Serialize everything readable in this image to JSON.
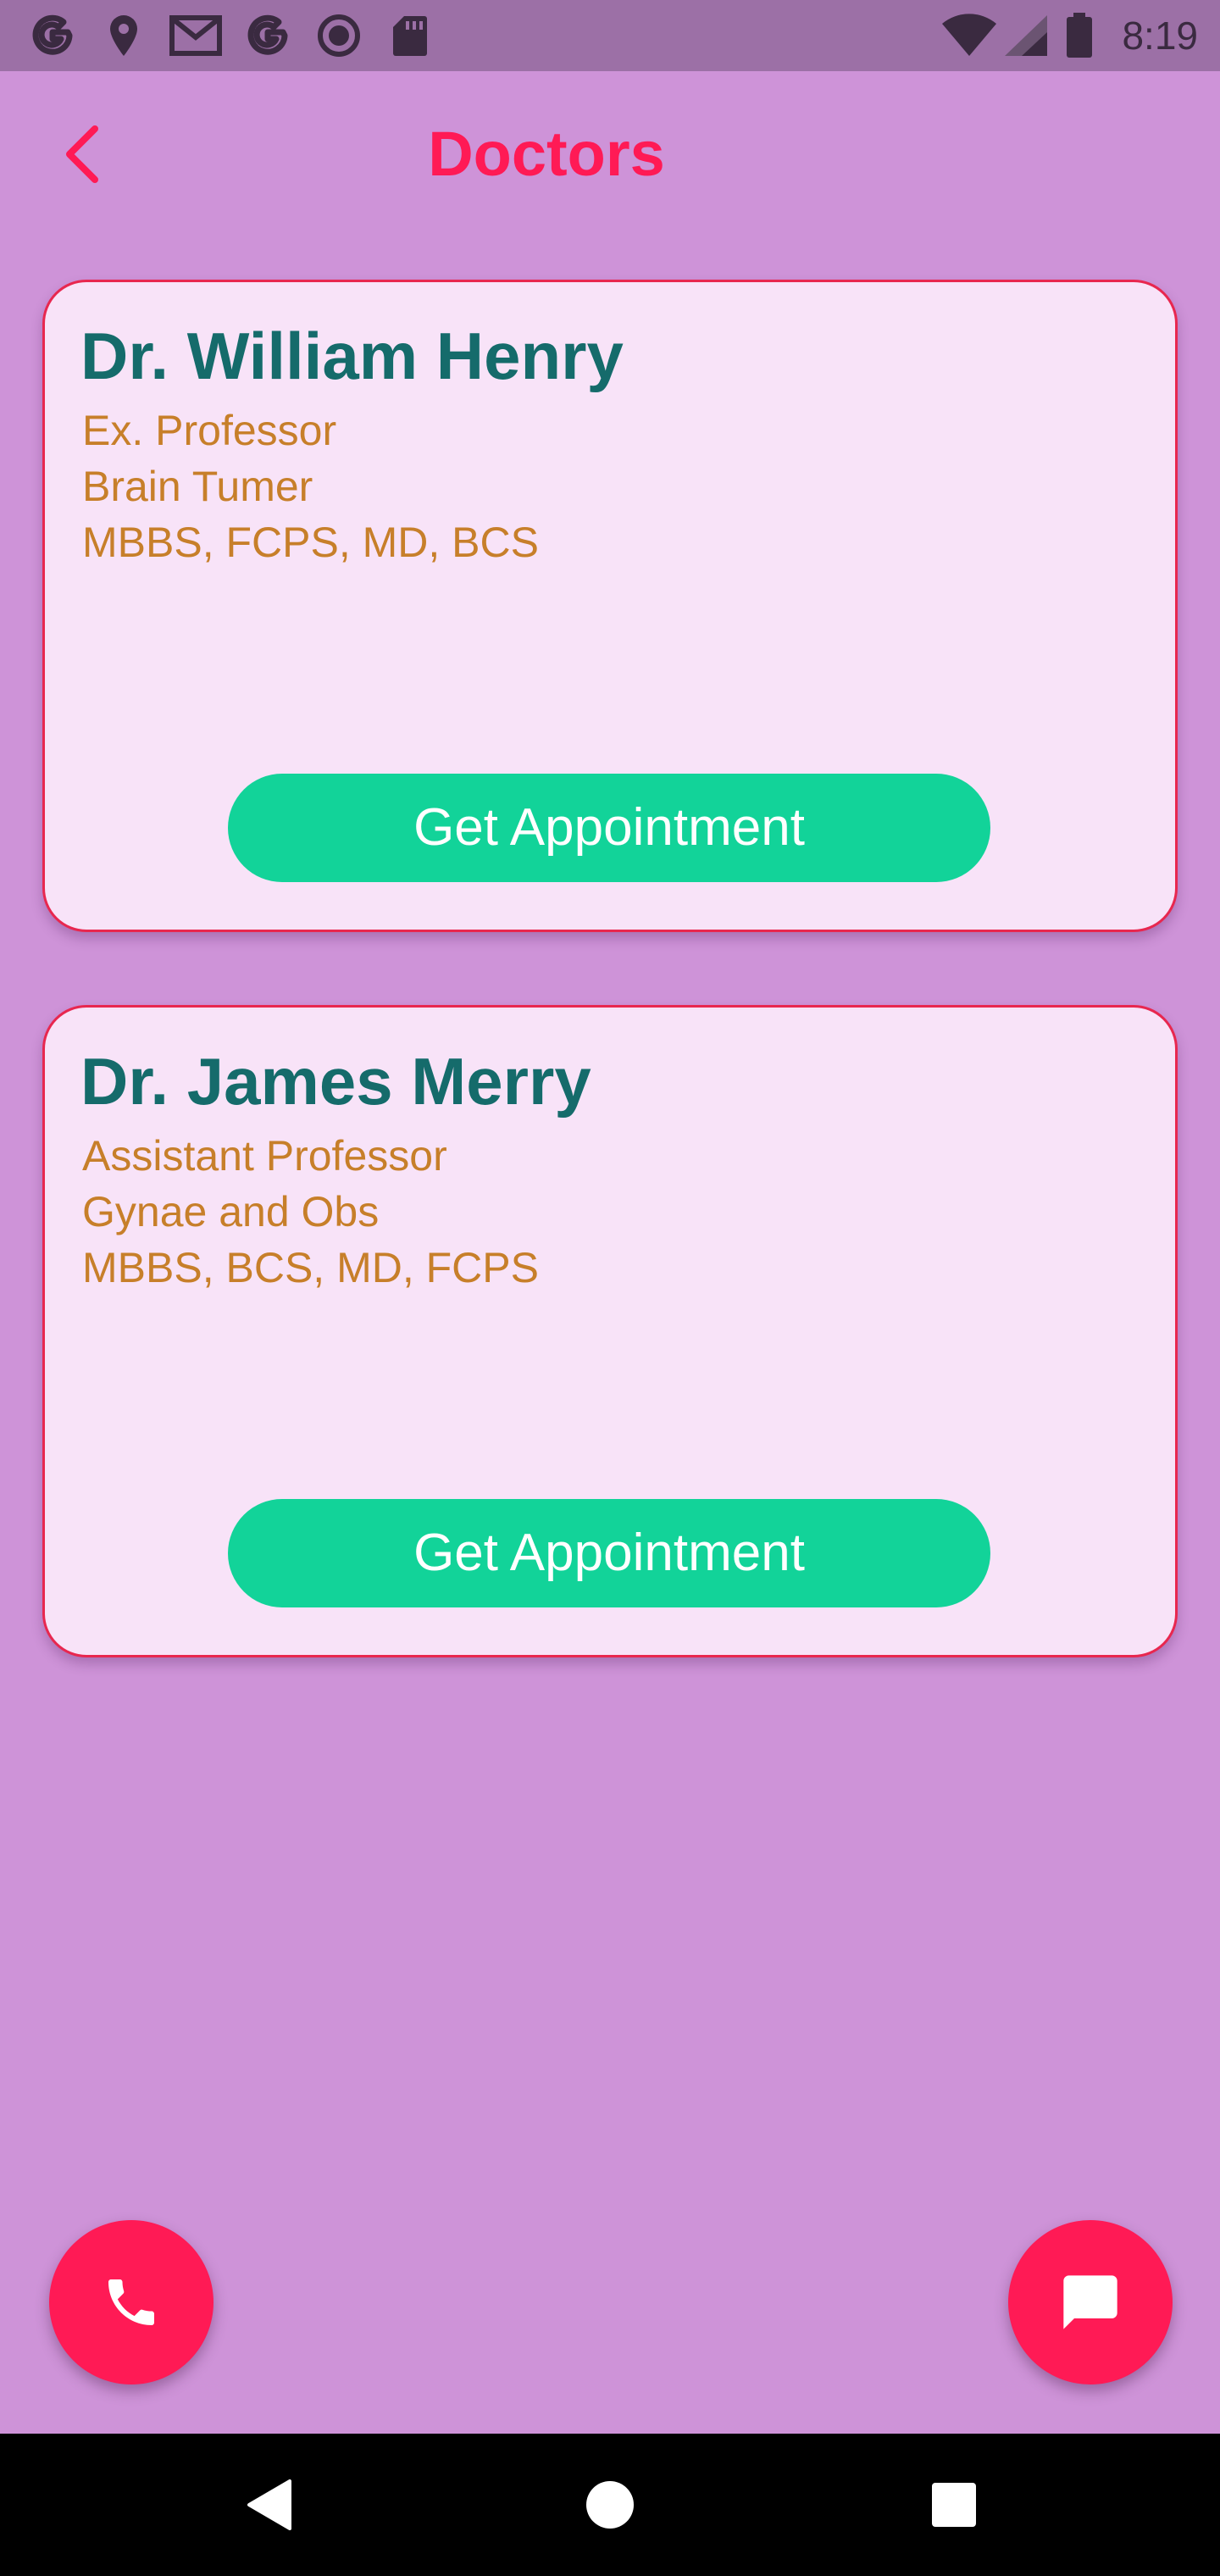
{
  "status_bar": {
    "time": "8:19",
    "left_icons": [
      "google-icon",
      "location-icon",
      "gmail-icon",
      "google-icon",
      "record-icon",
      "sd-card-icon"
    ],
    "right_icons": [
      "wifi-icon",
      "cell-signal-icon",
      "battery-icon"
    ]
  },
  "header": {
    "title": "Doctors",
    "back_icon": "chevron-left-icon"
  },
  "doctors": [
    {
      "name": "Dr. William Henry",
      "designation": "Ex. Professor",
      "specialty": "Brain Tumer",
      "degrees": "MBBS, FCPS, MD, BCS",
      "button_label": "Get Appointment"
    },
    {
      "name": "Dr. James Merry",
      "designation": "Assistant Professor",
      "specialty": "Gynae and Obs",
      "degrees": "MBBS, BCS, MD, FCPS",
      "button_label": "Get Appointment"
    }
  ],
  "fabs": {
    "call_icon": "phone-icon",
    "chat_icon": "chat-bubble-icon"
  },
  "nav_bar": {
    "icons": [
      "back-triangle-icon",
      "home-circle-icon",
      "recents-square-icon"
    ]
  },
  "colors": {
    "background": "#CE93D8",
    "status_bar": "#9C70A6",
    "accent": "#FF1A55",
    "card_background": "#F8E3F8",
    "card_border": "#E8274F",
    "doctor_name": "#156B6B",
    "doctor_info": "#C77F2A",
    "button": "#12D399"
  }
}
